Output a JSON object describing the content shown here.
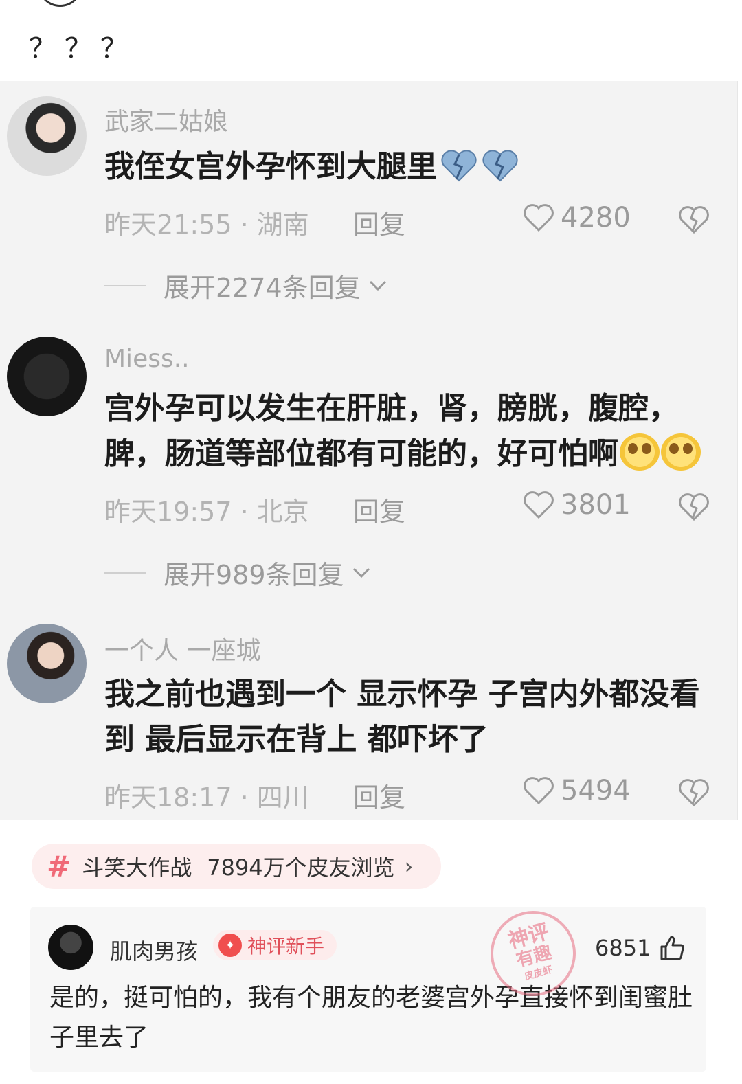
{
  "post": {
    "text": "？？？"
  },
  "comments": [
    {
      "username": "武家二姑娘",
      "text": "我侄女宫外孕怀到大腿里",
      "emojis": [
        "broken-heart-emoji",
        "broken-heart-emoji"
      ],
      "meta": "昨天21:55 · 湖南",
      "reply_label": "回复",
      "likes": "4280",
      "expand_label": "展开2274条回复"
    },
    {
      "username": "Miess..",
      "text": "宫外孕可以发生在肝脏，肾，膀胱，腹腔，脾，肠道等部位都有可能的，好可怕啊",
      "emojis": [
        "crying-face-emoji",
        "crying-face-emoji"
      ],
      "meta": "昨天19:57 · 北京",
      "reply_label": "回复",
      "likes": "3801",
      "expand_label": "展开989条回复"
    },
    {
      "username": "一个人 一座城",
      "text": "我之前也遇到一个  显示怀孕  子宫内外都没看到  最后显示在背上  都吓坏了",
      "meta": "昨天18:17 · 四川",
      "reply_label": "回复",
      "likes": "5494"
    }
  ],
  "topic": {
    "name": "斗笑大作战",
    "views": "7894万个皮友浏览",
    "arrow": "›"
  },
  "card": {
    "username": "肌肉男孩",
    "badge": "神评新手",
    "likes": "6851",
    "text": "是的，挺可怕的，我有个朋友的老婆宫外孕直接怀到闺蜜肚子里去了",
    "stamp": {
      "line1": "神评",
      "line2": "有趣",
      "line3": "皮皮虾"
    }
  },
  "colors": {
    "accent": "#f06a78",
    "muted": "#9a9a9a",
    "screenshot_bg": "#f3f3f3"
  }
}
